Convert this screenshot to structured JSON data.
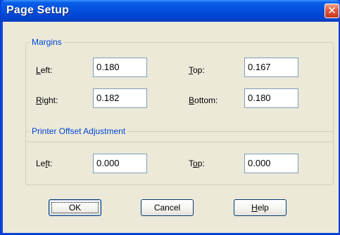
{
  "window": {
    "title": "Page Setup",
    "close_icon": "close-icon"
  },
  "margins": {
    "legend": "Margins",
    "left_label": "Left:",
    "left_mnemonic": "L",
    "left_rest": "eft:",
    "left_value": "0.180",
    "top_label": "Top:",
    "top_mnemonic": "T",
    "top_rest": "op:",
    "top_value": "0.167",
    "right_label": "Right:",
    "right_mnemonic": "R",
    "right_rest": "ight:",
    "right_value": "0.182",
    "bottom_label": "Bottom:",
    "bottom_mnemonic": "B",
    "bottom_rest": "ottom:",
    "bottom_value": "0.180"
  },
  "offset": {
    "legend": "Printer Offset Adjustment",
    "left_pre": "Le",
    "left_mnemonic": "f",
    "left_rest": "t:",
    "left_value": "0.000",
    "top_pre": "T",
    "top_mnemonic": "o",
    "top_rest": "p:",
    "top_value": "0.000"
  },
  "buttons": {
    "ok": "OK",
    "cancel": "Cancel",
    "help_mnemonic": "H",
    "help_rest": "elp"
  }
}
